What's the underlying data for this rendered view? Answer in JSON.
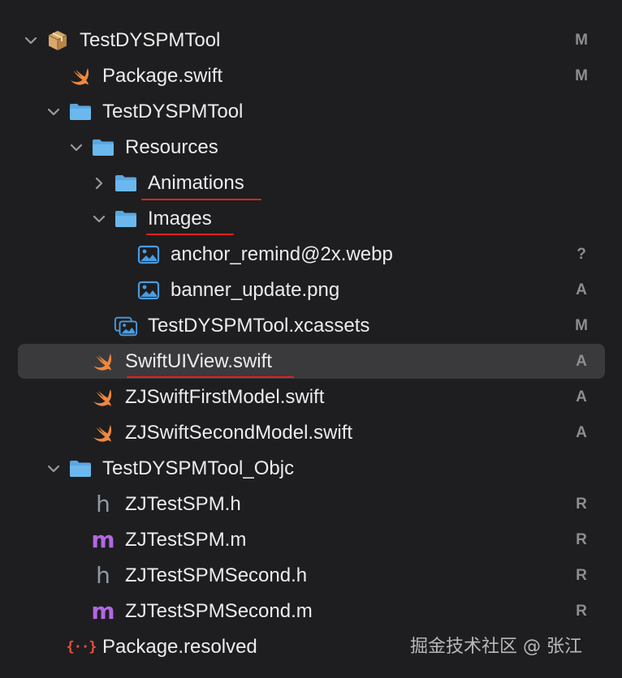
{
  "navigator": {
    "items": [
      {
        "label": "TestDYSPMTool",
        "status": "M",
        "icon": "package-icon",
        "expanded": true
      },
      {
        "label": "Package.swift",
        "status": "M",
        "icon": "swift-file-icon"
      },
      {
        "label": "TestDYSPMTool",
        "status": "",
        "icon": "folder-icon",
        "expanded": true
      },
      {
        "label": "Resources",
        "status": "",
        "icon": "folder-icon",
        "expanded": true
      },
      {
        "label": "Animations",
        "status": "",
        "icon": "folder-icon",
        "expanded": false
      },
      {
        "label": "Images",
        "status": "",
        "icon": "folder-icon",
        "expanded": true
      },
      {
        "label": "anchor_remind@2x.webp",
        "status": "?",
        "icon": "image-file-icon"
      },
      {
        "label": "banner_update.png",
        "status": "A",
        "icon": "image-file-icon"
      },
      {
        "label": "TestDYSPMTool.xcassets",
        "status": "M",
        "icon": "asset-catalog-icon"
      },
      {
        "label": "SwiftUIView.swift",
        "status": "A",
        "icon": "swift-file-icon",
        "selected": true
      },
      {
        "label": "ZJSwiftFirstModel.swift",
        "status": "A",
        "icon": "swift-file-icon"
      },
      {
        "label": "ZJSwiftSecondModel.swift",
        "status": "A",
        "icon": "swift-file-icon"
      },
      {
        "label": "TestDYSPMTool_Objc",
        "status": "",
        "icon": "folder-icon",
        "expanded": true
      },
      {
        "label": "ZJTestSPM.h",
        "status": "R",
        "icon": "header-file-icon"
      },
      {
        "label": "ZJTestSPM.m",
        "status": "R",
        "icon": "objc-file-icon"
      },
      {
        "label": "ZJTestSPMSecond.h",
        "status": "R",
        "icon": "header-file-icon"
      },
      {
        "label": "ZJTestSPMSecond.m",
        "status": "R",
        "icon": "objc-file-icon"
      },
      {
        "label": "Package.resolved",
        "status": "",
        "icon": "json-file-icon"
      }
    ]
  },
  "icons": {
    "header_glyph": "h",
    "objc_glyph": "m",
    "json_glyph": "{··}"
  },
  "watermark": "掘金技术社区 @ 张江",
  "colors": {
    "background": "#1e1e20",
    "selection": "#3a3a3d",
    "text": "#ececec",
    "status": "#8d8d92",
    "folder": "#5aa7e0",
    "swift": "#f0883e",
    "annotation_underline": "#e3211d"
  }
}
